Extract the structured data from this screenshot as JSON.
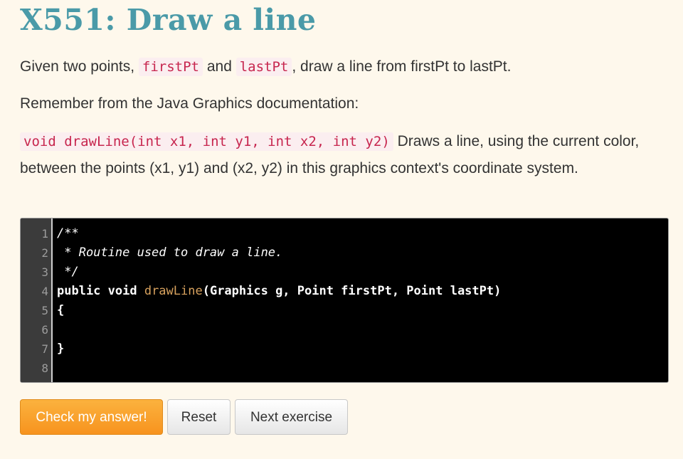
{
  "title": "X551: Draw a line",
  "intro": {
    "pre": "Given two points, ",
    "code1": "firstPt",
    "mid": " and ",
    "code2": "lastPt",
    "post": ", draw a line from firstPt to lastPt."
  },
  "remember": "Remember from the Java Graphics documentation:",
  "doc": {
    "signature": "void drawLine(int x1, int y1, int x2, int y2)",
    "description": " Draws a line, using the current color, between the points (x1, y1) and (x2, y2) in this graphics context's coordinate system."
  },
  "editor": {
    "line_numbers": [
      "1",
      "2",
      "3",
      "4",
      "5",
      "6",
      "7",
      "8"
    ],
    "lines": {
      "l1": "/**",
      "l2": " * Routine used to draw a line.",
      "l3": " */",
      "l4_kw": "public void ",
      "l4_fn": "drawLine",
      "l4_rest": "(Graphics g, Point firstPt, Point lastPt)",
      "l5": "{",
      "l6": "",
      "l7": "}",
      "l8": ""
    }
  },
  "buttons": {
    "check": "Check my answer!",
    "reset": "Reset",
    "next": "Next exercise"
  },
  "colors": {
    "title": "#4a9aa8",
    "background": "#fef8ec",
    "inline_code": "#c7254e",
    "check_button": "#f7931e"
  }
}
